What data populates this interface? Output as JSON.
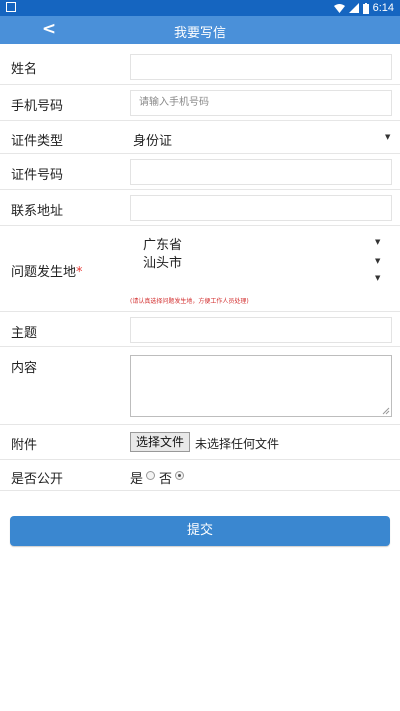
{
  "status_bar": {
    "time": "6:14"
  },
  "header": {
    "back": "<",
    "title": "我要写信"
  },
  "form": {
    "name_label": "姓名",
    "phone_label": "手机号码",
    "phone_placeholder": "请输入手机号码",
    "id_type_label": "证件类型",
    "id_type_value": "身份证",
    "id_number_label": "证件号码",
    "address_label": "联系地址",
    "location_label": "问题发生地",
    "location_required": "*",
    "province": "广东省",
    "city": "汕头市",
    "district": "",
    "location_hint": "(请认真选择问题发生地，方便工作人员处理)",
    "subject_label": "主题",
    "content_label": "内容",
    "attachment_label": "附件",
    "file_button": "选择文件",
    "file_status": "未选择任何文件",
    "public_label": "是否公开",
    "public_yes": "是",
    "public_no": "否",
    "public_selected": "否"
  },
  "submit_label": "提交",
  "colors": {
    "status_bar": "#1565c0",
    "header": "#4a90d9",
    "submit": "#3a87d0",
    "hint": "#d32f2f"
  }
}
